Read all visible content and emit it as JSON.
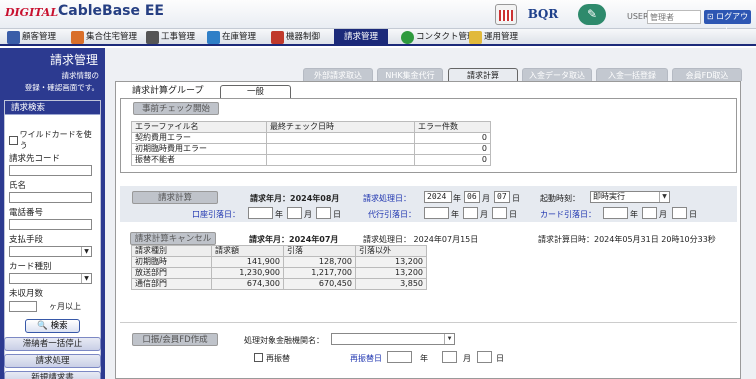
{
  "header": {
    "logo_prefix": "DIGITAL",
    "logo_name": "CableBase EE",
    "bqr": "BQR",
    "user_label": "USER",
    "user_placeholder": "管理者",
    "logout": "ログアウト",
    "icons": [
      "calendar-icon",
      "edit-icon",
      "logout-icon"
    ]
  },
  "nav": {
    "items": [
      "顧客管理",
      "集合住宅管理",
      "工事管理",
      "在庫管理",
      "機器制御",
      "請求管理",
      "コンタクト管理",
      "運用管理"
    ],
    "active": "請求管理"
  },
  "sidebar": {
    "title": "請求管理",
    "desc1": "請求情報の",
    "desc2": "登録・確認画面です。",
    "search_head": "請求検索",
    "wildcard": "ワイルドカードを使う",
    "billing_code": "請求先コード",
    "name": "氏名",
    "phone": "電話番号",
    "payment": "支払手段",
    "card_type": "カード種別",
    "unpaid": "未収月数",
    "months_over": "ヶ月以上",
    "search_btn": "検索",
    "btn_suspend": "滞納者一括停止",
    "btn_process": "請求処理",
    "btn_partial": "新規請求書"
  },
  "tabs": [
    "外部請求取込",
    "NHK集金代行",
    "請求計算",
    "入金データ取込",
    "入金一括登録",
    "会員FD取込"
  ],
  "active_tab": "請求計算",
  "group": {
    "title": "請求計算グループ",
    "tab": "一般"
  },
  "precheck": {
    "button": "事前チェック開始",
    "headers": [
      "エラーファイル名",
      "最終チェック日時",
      "エラー件数"
    ],
    "rows": [
      {
        "name": "契約費用エラー",
        "date": "",
        "count": "0"
      },
      {
        "name": "初期臨時費用エラー",
        "date": "",
        "count": "0"
      },
      {
        "name": "振替不能者",
        "date": "",
        "count": "0"
      }
    ]
  },
  "calc": {
    "button": "請求計算",
    "ym": "請求年月：2024年08月",
    "proc_label": "請求処理日：",
    "year": "2024",
    "month": "06",
    "day": "07",
    "year_u": "年",
    "month_u": "月",
    "day_u": "日",
    "start_label": "起動時刻：",
    "start_value": "即時実行",
    "acct_label": "口座引落日：",
    "agent_label": "代行引落日：",
    "card_label": "カード引落日："
  },
  "cancel": {
    "button": "請求計算キャンセル",
    "ym": "請求年月：2024年07月",
    "proc": "請求処理日： 2024年07月15日",
    "calc_time": "請求計算日時：2024年05月31日 20時10分33秒",
    "headers": [
      "請求種別",
      "請求額",
      "引落",
      "引落以外"
    ],
    "rows": [
      [
        "初期臨時",
        "141,900",
        "128,700",
        "13,200"
      ],
      [
        "放送部門",
        "1,230,900",
        "1,217,700",
        "13,200"
      ],
      [
        "通信部門",
        "674,300",
        "670,450",
        "3,850"
      ]
    ]
  },
  "fd": {
    "button": "口振/会員FD作成",
    "bank_label": "処理対象金融機関名：",
    "refund": "再振替",
    "refund_date_label": "再振替日"
  }
}
